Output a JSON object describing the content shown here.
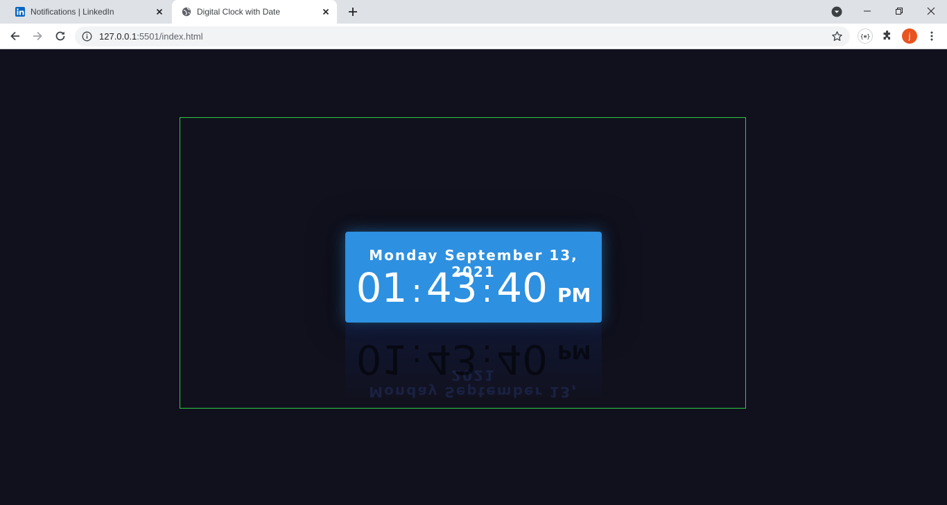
{
  "browser": {
    "tabs": [
      {
        "title": "Notifications | LinkedIn",
        "icon": "linkedin-icon",
        "active": false
      },
      {
        "title": "Digital Clock with Date",
        "icon": "globe-icon",
        "active": true
      }
    ],
    "address": {
      "host": "127.0.0.1",
      "rest": ":5501/index.html"
    },
    "extension_json_label": "{≡}",
    "profile_initial": "j"
  },
  "clock": {
    "date": "Monday September 13, 2021",
    "hours": "01",
    "separator": ":",
    "minutes": "43",
    "seconds": "40",
    "period": "PM"
  },
  "colors": {
    "background": "#11111e",
    "clock_panel": "#2e90e0",
    "stage_border": "#2ecc40",
    "avatar": "#e8531f"
  }
}
